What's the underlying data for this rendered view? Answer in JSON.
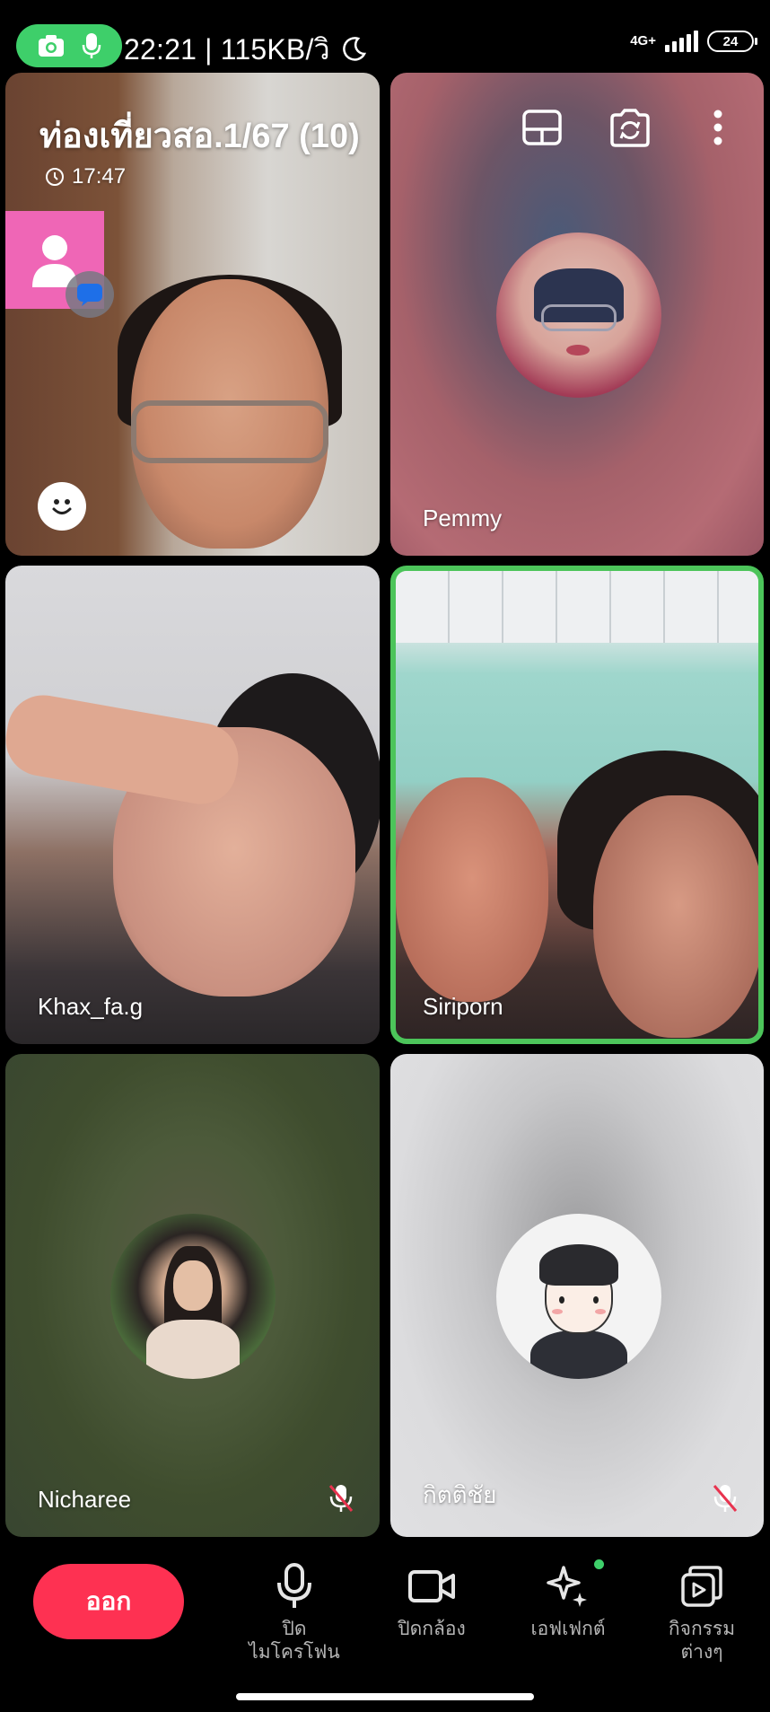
{
  "status_bar": {
    "time_speed": "22:21 | 115KB/วิ",
    "network": "4G+",
    "battery": "24"
  },
  "call": {
    "title": "ท่องเที่ยวสอ.1/67 (10)",
    "duration": "17:47"
  },
  "participants": [
    {
      "name": "",
      "muted": false
    },
    {
      "name": "Pemmy",
      "muted": false
    },
    {
      "name": "Khax_fa.g",
      "muted": false
    },
    {
      "name": "Siriporn",
      "muted": false,
      "speaking": true
    },
    {
      "name": "Nicharee",
      "muted": true
    },
    {
      "name": "กิตติชัย",
      "muted": true
    }
  ],
  "bottom_bar": {
    "leave_label": "ออก",
    "mic_label_line1": "ปิด",
    "mic_label_line2": "ไมโครโฟน",
    "camera_label": "ปิดกล้อง",
    "effect_label": "เอฟเฟกต์",
    "activity_label_line1": "กิจกรรม",
    "activity_label_line2": "ต่างๆ"
  },
  "colors": {
    "accent_green": "#3ecf6a",
    "leave_red": "#fe3152",
    "speaking_border": "#4cc45a",
    "self_preview_pink": "#ef66b6"
  },
  "icons": [
    "camera-icon",
    "mic-icon",
    "moon-icon",
    "clock-icon",
    "person-icon",
    "chat-icon",
    "smile-icon",
    "layout-icon",
    "switch-camera-icon",
    "more-icon",
    "mic-muted-icon",
    "video-icon",
    "sparkle-icon",
    "activity-icon"
  ]
}
